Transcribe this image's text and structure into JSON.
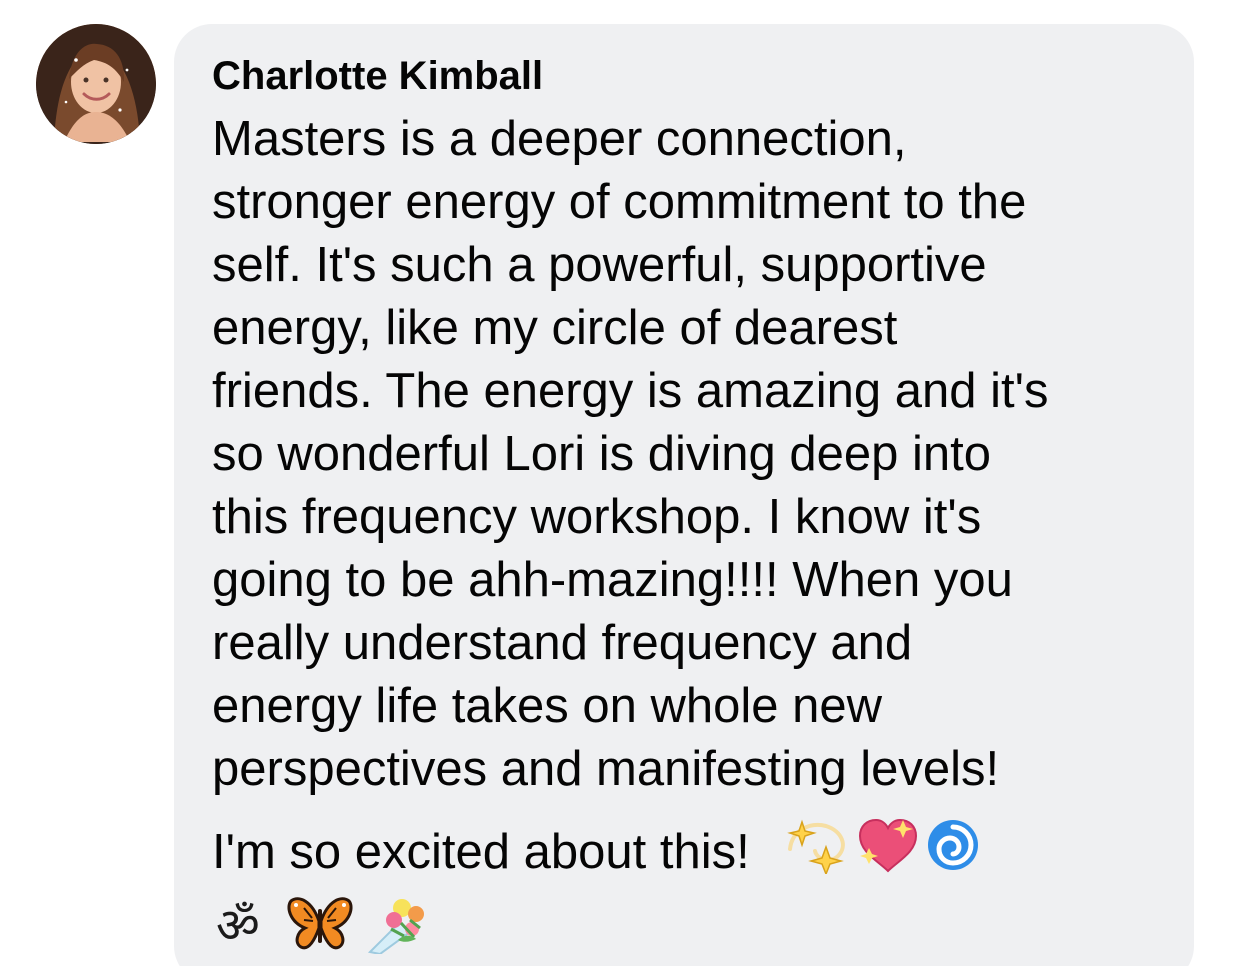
{
  "comment": {
    "author": "Charlotte Kimball",
    "lines": [
      "Masters is a deeper connection,",
      "stronger energy of commitment to the",
      "self.  It's such a powerful, supportive",
      "energy, like my circle of dearest",
      "friends.  The energy is amazing and it's",
      "so wonderful Lori is diving deep into",
      "this frequency workshop.  I know it's",
      "going to be ahh-mazing!!!! When you",
      "really understand frequency and",
      "energy life takes on whole new",
      "perspectives and manifesting levels!"
    ],
    "closing": "I'm so excited about this!",
    "emojis_line1": [
      "dizzy-stars-icon",
      "sparkling-heart-icon",
      "cyclone-icon"
    ],
    "emojis_line2": [
      "om-icon",
      "butterfly-icon",
      "bouquet-icon"
    ]
  },
  "colors": {
    "bubble": "#eff0f2",
    "text": "#050505"
  }
}
